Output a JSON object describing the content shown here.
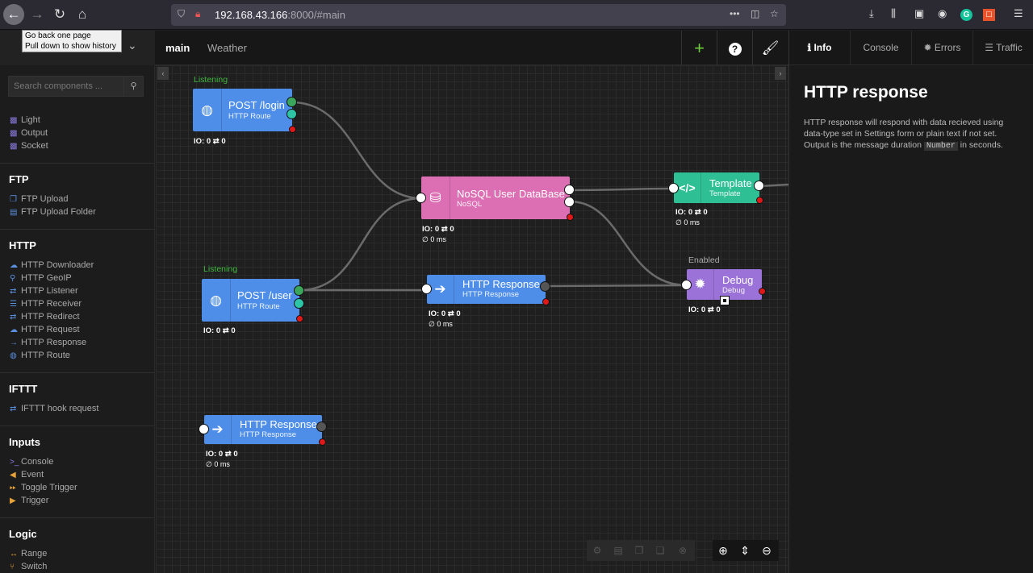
{
  "browser": {
    "url_host": "192.168.43.166",
    "url_rest": ":8000/#main",
    "tooltip_line1": "Go back one page",
    "tooltip_line2": "Pull down to show history"
  },
  "header": {
    "tabs": [
      {
        "label": "main"
      },
      {
        "label": "Weather"
      }
    ]
  },
  "panel": {
    "tabs": [
      {
        "label": "Info",
        "icon": "info-icon"
      },
      {
        "label": "Console",
        "icon": ""
      },
      {
        "label": "Errors",
        "icon": "bug-icon"
      },
      {
        "label": "Traffic",
        "icon": "list-icon"
      }
    ],
    "title": "HTTP response",
    "desc_part1": "HTTP response will respond with data recieved using data-type set in Settings form or plain text if not set. Output is the message duration",
    "desc_code": "Number",
    "desc_part2": "in seconds."
  },
  "sidebar": {
    "search_placeholder": "Search components ...",
    "items_top": [
      "Light",
      "Output",
      "Socket"
    ],
    "sections": [
      {
        "heading": "FTP",
        "items": [
          "FTP Upload",
          "FTP Upload Folder"
        ]
      },
      {
        "heading": "HTTP",
        "items": [
          "HTTP Downloader",
          "HTTP GeoIP",
          "HTTP Listener",
          "HTTP Receiver",
          "HTTP Redirect",
          "HTTP Request",
          "HTTP Response",
          "HTTP Route"
        ]
      },
      {
        "heading": "IFTTT",
        "items": [
          "IFTTT hook request"
        ]
      },
      {
        "heading": "Inputs",
        "items": [
          "Console",
          "Event",
          "Toggle Trigger",
          "Trigger"
        ]
      },
      {
        "heading": "Logic",
        "items": [
          "Range",
          "Switch"
        ]
      }
    ]
  },
  "colors": {
    "route": "#4e8ee8",
    "nosql": "#dc6fb4",
    "template": "#2fbf95",
    "debug": "#9a72d8",
    "listening": "#3fb83f"
  },
  "nodes": {
    "post_login": {
      "state": "Listening",
      "title": "POST /login",
      "subtitle": "HTTP Route",
      "io": "IO: 0 ⇄ 0"
    },
    "nosql": {
      "title": "NoSQL User DataBase",
      "subtitle": "NoSQL",
      "io": "IO: 0 ⇄ 0",
      "ms": "∅ 0 ms"
    },
    "template": {
      "title": "Template",
      "subtitle": "Template",
      "io": "IO: 0 ⇄ 0",
      "ms": "∅ 0 ms"
    },
    "post_user": {
      "state": "Listening",
      "title": "POST /user",
      "subtitle": "HTTP Route",
      "io": "IO: 0 ⇄ 0"
    },
    "response1": {
      "title": "HTTP Response",
      "subtitle": "HTTP Response",
      "io": "IO: 0 ⇄ 0",
      "ms": "∅ 0 ms"
    },
    "debug": {
      "state": "Enabled",
      "title": "Debug",
      "subtitle": "Debug",
      "io": "IO: 0 ⇄ 0"
    },
    "response2": {
      "title": "HTTP Response",
      "subtitle": "HTTP Response",
      "io": "IO: 0 ⇄ 0",
      "ms": "∅ 0 ms"
    }
  }
}
